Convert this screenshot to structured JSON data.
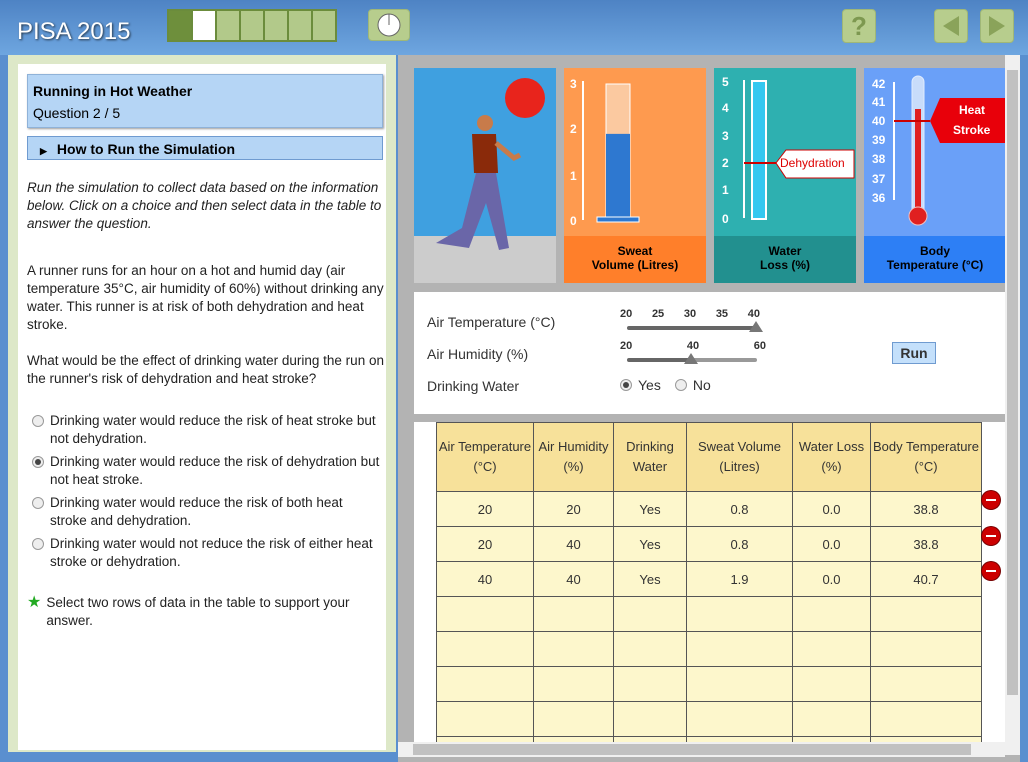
{
  "header": {
    "brand": "PISA 2015",
    "progress_total": 7,
    "progress_current": 2,
    "help": "?"
  },
  "question": {
    "title": "Running in Hot Weather",
    "number": "Question 2 / 5",
    "howto": "How to Run the Simulation",
    "instructions": "Run the simulation to collect data based on the information below. Click on a choice and then select data in the table to answer the question.",
    "scenario": "A runner runs for an hour on a hot and humid day (air temperature 35°C, air humidity of 60%) without drinking any water. This runner is at risk of both dehydration and heat stroke.",
    "prompt": "What would be the effect of drinking water during the run on the runner's risk of dehydration and heat stroke?",
    "options": [
      {
        "label": "Drinking water would reduce the risk of heat stroke but not dehydration.",
        "selected": false
      },
      {
        "label": "Drinking water would reduce the risk of dehydration but not heat stroke.",
        "selected": true
      },
      {
        "label": "Drinking water would reduce the risk of both heat stroke and dehydration.",
        "selected": false
      },
      {
        "label": "Drinking water would not reduce the risk of either heat stroke or dehydration.",
        "selected": false
      }
    ],
    "task": "Select two rows of data in the table to support your answer."
  },
  "gauges": {
    "sweat": {
      "label1": "Sweat",
      "label2": "Volume (Litres)",
      "ticks": [
        "3",
        "2",
        "1",
        "0"
      ],
      "value": 1.9,
      "max": 3
    },
    "water": {
      "label1": "Water",
      "label2": "Loss (%)",
      "ticks": [
        "5",
        "4",
        "3",
        "2",
        "1",
        "0"
      ],
      "value": 0.0,
      "max": 5,
      "marker": "Dehydration"
    },
    "body": {
      "label1": "Body",
      "label2": "Temperature (°C)",
      "ticks": [
        "42",
        "41",
        "40",
        "39",
        "38",
        "37",
        "36"
      ],
      "value": 40.7,
      "marker1": "Heat",
      "marker2": "Stroke"
    },
    "colors": {
      "sweat": "#fe9a4f",
      "water": "#2eb0b0",
      "body": "#6aa0f8"
    }
  },
  "controls": {
    "air_temp_label": "Air Temperature (°C)",
    "air_temp_ticks": [
      "20",
      "25",
      "30",
      "35",
      "40"
    ],
    "air_temp_value": 40,
    "humidity_label": "Air Humidity (%)",
    "humidity_ticks": [
      "20",
      "40",
      "60"
    ],
    "humidity_value": 40,
    "water_label": "Drinking Water",
    "yes": "Yes",
    "no": "No",
    "water_value": "Yes",
    "run": "Run"
  },
  "table": {
    "headers": [
      "Air Temperature (°C)",
      "Air Humidity (%)",
      "Drinking Water",
      "Sweat Volume (Litres)",
      "Water Loss (%)",
      "Body Temperature (°C)"
    ],
    "rows": [
      [
        "20",
        "20",
        "Yes",
        "0.8",
        "0.0",
        "38.8"
      ],
      [
        "20",
        "40",
        "Yes",
        "0.8",
        "0.0",
        "38.8"
      ],
      [
        "40",
        "40",
        "Yes",
        "1.9",
        "0.0",
        "40.7"
      ]
    ],
    "empty_rows": 5
  }
}
